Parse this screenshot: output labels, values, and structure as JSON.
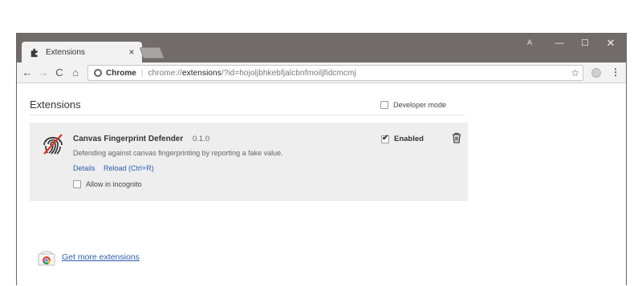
{
  "browser": {
    "tab_title": "Extensions",
    "tab_close": "×",
    "user_initial": "A",
    "window_controls": {
      "minimize": "—",
      "maximize": "☐",
      "close": "✕"
    },
    "nav": {
      "back": "←",
      "forward": "→",
      "reload": "C",
      "home": "⌂"
    },
    "omnibox": {
      "scheme_label": "Chrome",
      "separator": "|",
      "url_prefix": "chrome://",
      "url_host": "extensions",
      "url_rest": "/?id=hojoljbhkebfjalcbnfmoiljfidcmcmj"
    },
    "star_icon": "☆",
    "menu_icon": "⋮"
  },
  "page": {
    "title": "Extensions",
    "developer_mode_label": "Developer mode",
    "developer_mode_checked": false
  },
  "extension": {
    "name": "Canvas Fingerprint Defender",
    "version": "0.1.0",
    "description": "Defending against canvas fingerprinting by reporting a fake value.",
    "details_link": "Details",
    "reload_link": "Reload (Ctrl+R)",
    "incognito_label": "Allow in incognito",
    "incognito_checked": false,
    "enabled_label": "Enabled",
    "enabled_checked": true
  },
  "footer": {
    "more_extensions_link": "Get more extensions"
  },
  "colors": {
    "titlebar": "#716b69",
    "link": "#2a5db0",
    "card": "#eeeeee"
  }
}
